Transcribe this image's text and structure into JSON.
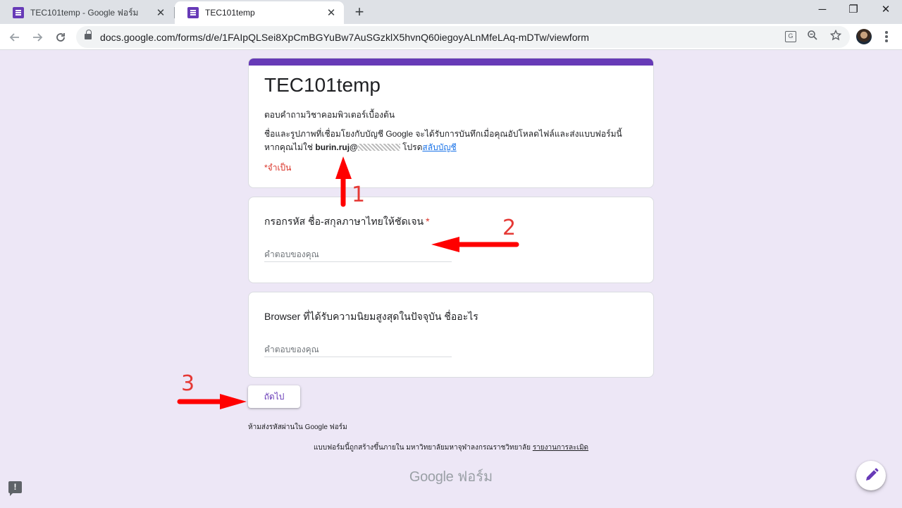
{
  "browser": {
    "tabs": [
      {
        "title": "TEC101temp - Google ฟอร์ม",
        "close": "✕"
      },
      {
        "title": "TEC101temp",
        "close": "✕"
      }
    ],
    "new_tab": "+",
    "window_controls": {
      "minimize": "─",
      "restore": "❐",
      "close": "✕"
    },
    "url": "docs.google.com/forms/d/e/1FAIpQLSei8XpCmBGYuBw7AuSGzklX5hvnQ60iegoyALnMfeLAq-mDTw/viewform",
    "icons": [
      "back-icon",
      "forward-icon",
      "reload-icon",
      "lock-icon",
      "translate-icon",
      "zoom-icon",
      "star-icon",
      "profile-avatar",
      "menu-icon"
    ]
  },
  "form": {
    "title": "TEC101temp",
    "description": "ตอบคำถามวิชาคอมพิวเตอร์เบื้องต้น",
    "account_note": {
      "line1": "ชื่อและรูปภาพที่เชื่อมโยงกับบัญชี Google จะได้รับการบันทึกเมื่อคุณอัปโหลดไฟล์และส่งแบบฟอร์มนี้",
      "line2_prefix": "หากคุณไม่ใช่",
      "email": "burin.ruj@",
      "line2_mid": "โปรด",
      "switch_link": "สลับบัญชี"
    },
    "required_note": "*จำเป็น",
    "questions": [
      {
        "title": "กรอกรหัส ชื่อ-สกุลภาษาไทยให้ชัดเจน",
        "required_mark": "*",
        "placeholder": "คำตอบของคุณ"
      },
      {
        "title": "Browser ที่ได้รับความนิยมสูงสุดในปัจจุบัน ชื่ออะไร",
        "placeholder": "คำตอบของคุณ"
      }
    ],
    "next_button": "ถัดไป",
    "password_warning": "ห้ามส่งรหัสผ่านใน Google ฟอร์ม",
    "footer": {
      "text": "แบบฟอร์มนี้ถูกสร้างขึ้นภายใน มหาวิทยาลัยมหาจุฬาลงกรณราชวิทยาลัย",
      "report_link": "รายงานการละเมิด"
    },
    "brand": {
      "google": "Google",
      "forms": "ฟอร์ม"
    }
  },
  "annotations": {
    "labels": [
      "1",
      "2",
      "3"
    ],
    "color": "#ff0000"
  },
  "colors": {
    "accent": "#673ab7",
    "background": "#ede7f6",
    "required": "#d93025",
    "link": "#1a73e8"
  }
}
